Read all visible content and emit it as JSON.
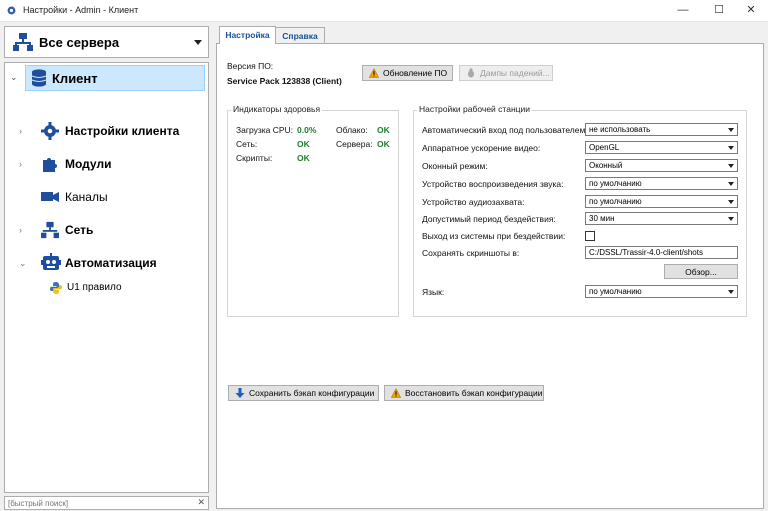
{
  "window": {
    "title": "Настройки - Admin - Клиент",
    "minimize": "—",
    "maximize": "☐",
    "close": "✕"
  },
  "server_select": {
    "label": "Все сервера"
  },
  "tree": {
    "items": [
      {
        "label": "Клиент",
        "icon": "database-icon",
        "selected": true
      },
      {
        "label": "Настройки клиента",
        "icon": "gear-icon"
      },
      {
        "label": "Модули",
        "icon": "puzzle-icon"
      },
      {
        "label": "Каналы",
        "icon": "camera-icon"
      },
      {
        "label": "Сеть",
        "icon": "network-icon"
      },
      {
        "label": "Автоматизация",
        "icon": "robot-icon"
      },
      {
        "label": "U1 правило",
        "icon": "python-icon"
      }
    ]
  },
  "search": {
    "placeholder": "[быстрый поиск]",
    "clear": "✕"
  },
  "tabs": [
    {
      "label": "Настройка",
      "active": true
    },
    {
      "label": "Справка",
      "active": false
    }
  ],
  "version": {
    "label": "Версия ПО:",
    "value": "Service Pack 123838 (Client)",
    "update_button": "Обновление ПО",
    "dumps_button": "Дампы падений..."
  },
  "health": {
    "title": "Индикаторы здоровья",
    "items": [
      {
        "label": "Загрузка CPU:",
        "value": "0.0%"
      },
      {
        "label": "Облако:",
        "value": "OK"
      },
      {
        "label": "Сеть:",
        "value": "OK"
      },
      {
        "label": "Сервера:",
        "value": "OK"
      },
      {
        "label": "Скрипты:",
        "value": "OK"
      }
    ]
  },
  "workstation": {
    "title": "Настройки рабочей станции",
    "rows": [
      {
        "label": "Автоматический вход под пользователем:",
        "value": "не использовать"
      },
      {
        "label": "Аппаратное ускорение видео:",
        "value": "OpenGL"
      },
      {
        "label": "Оконный режим:",
        "value": "Оконный"
      },
      {
        "label": "Устройство воспроизведения звука:",
        "value": "по умолчанию"
      },
      {
        "label": "Устройство аудиозахвата:",
        "value": "по умолчанию"
      },
      {
        "label": "Допустимый период бездействия:",
        "value": "30 мин"
      }
    ],
    "logout_label": "Выход из системы при бездействии:",
    "screenshots_label": "Сохранять скриншоты в:",
    "screenshots_path": "C:/DSSL/Trassir-4.0-client/shots",
    "browse_button": "Обзор...",
    "language_label": "Язык:",
    "language_value": "по умолчанию"
  },
  "backup": {
    "save_button": "Сохранить бэкап конфигурации",
    "restore_button": "Восстановить бэкап конфигурации"
  },
  "colors": {
    "ok": "#1e7d2c",
    "selected_bg": "#cce8ff",
    "tab_text": "#1a4f9c",
    "warning": "#f0a400",
    "save_arrow": "#1f5fbf"
  }
}
